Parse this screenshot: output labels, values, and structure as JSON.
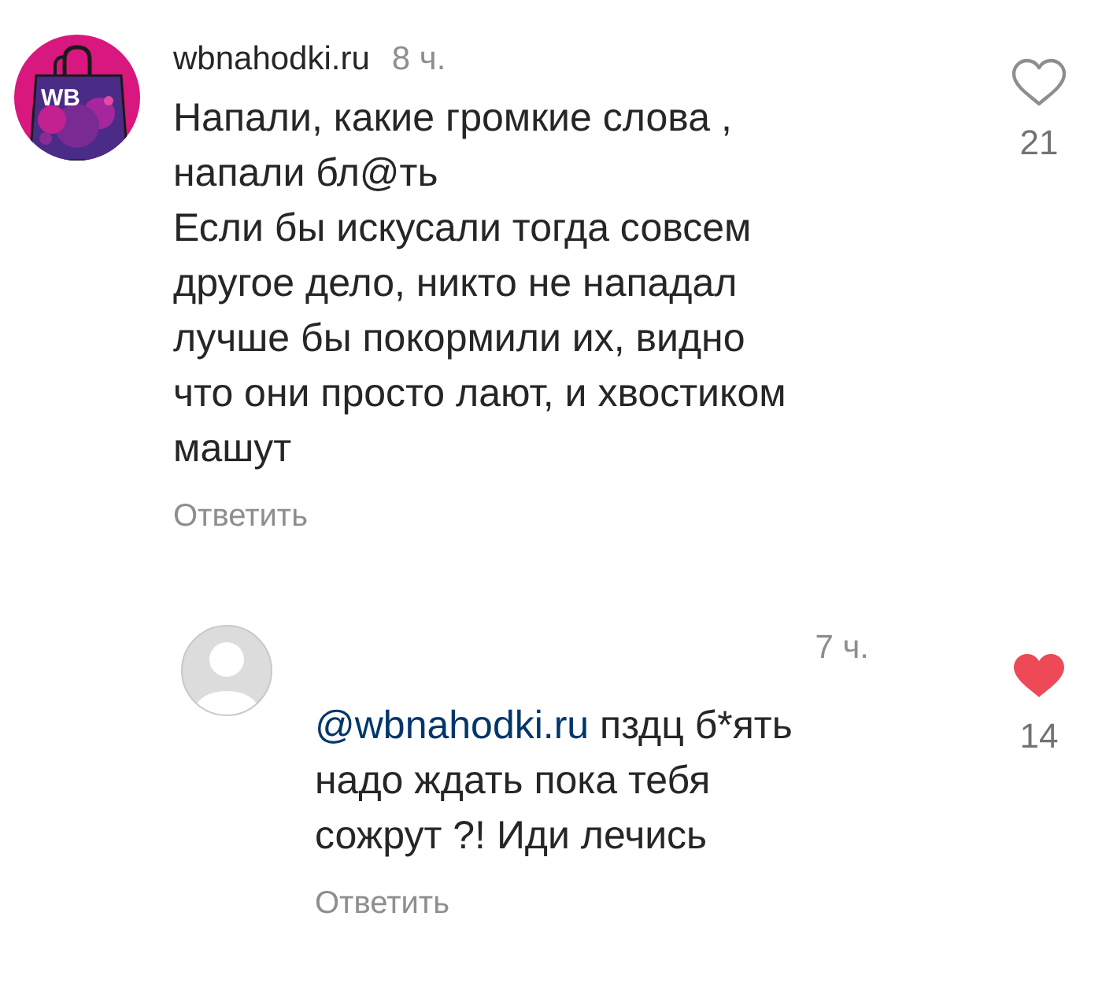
{
  "comments": [
    {
      "kind": "comment",
      "avatar": {
        "kind": "logo",
        "text": "WB"
      },
      "username": "wbnahodki.ru",
      "time": "8 ч.",
      "text": "Напали, какие громкие слова ,\nнапали бл@ть\nЕсли бы искусали тогда совсем\nдругое дело, никто не нападал\nлучше бы покормили их, видно\nчто они просто лают, и хвостиком\nмашут",
      "reply_label": "Ответить",
      "liked": false,
      "likes": "21"
    },
    {
      "kind": "reply",
      "avatar": {
        "kind": "placeholder"
      },
      "time": "7 ч.",
      "mention": "@wbnahodki.ru",
      "text": "пздц б*ять\nнадо ждать пока тебя\nсожрут ?! Иди лечись",
      "reply_label": "Ответить",
      "liked": true,
      "likes": "14"
    }
  ]
}
